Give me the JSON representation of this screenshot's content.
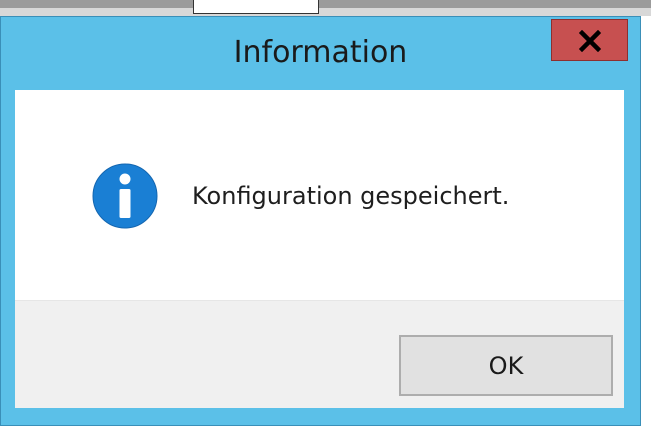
{
  "dialog": {
    "title": "Information",
    "message": "Konfiguration gespeichert.",
    "ok_label": "OK",
    "close_icon": "close-icon",
    "message_icon": "info-icon"
  },
  "colors": {
    "title_bar": "#5bc0e8",
    "close_button": "#c75050",
    "info_icon": "#1a7fd4",
    "button_panel": "#f0f0f0"
  }
}
